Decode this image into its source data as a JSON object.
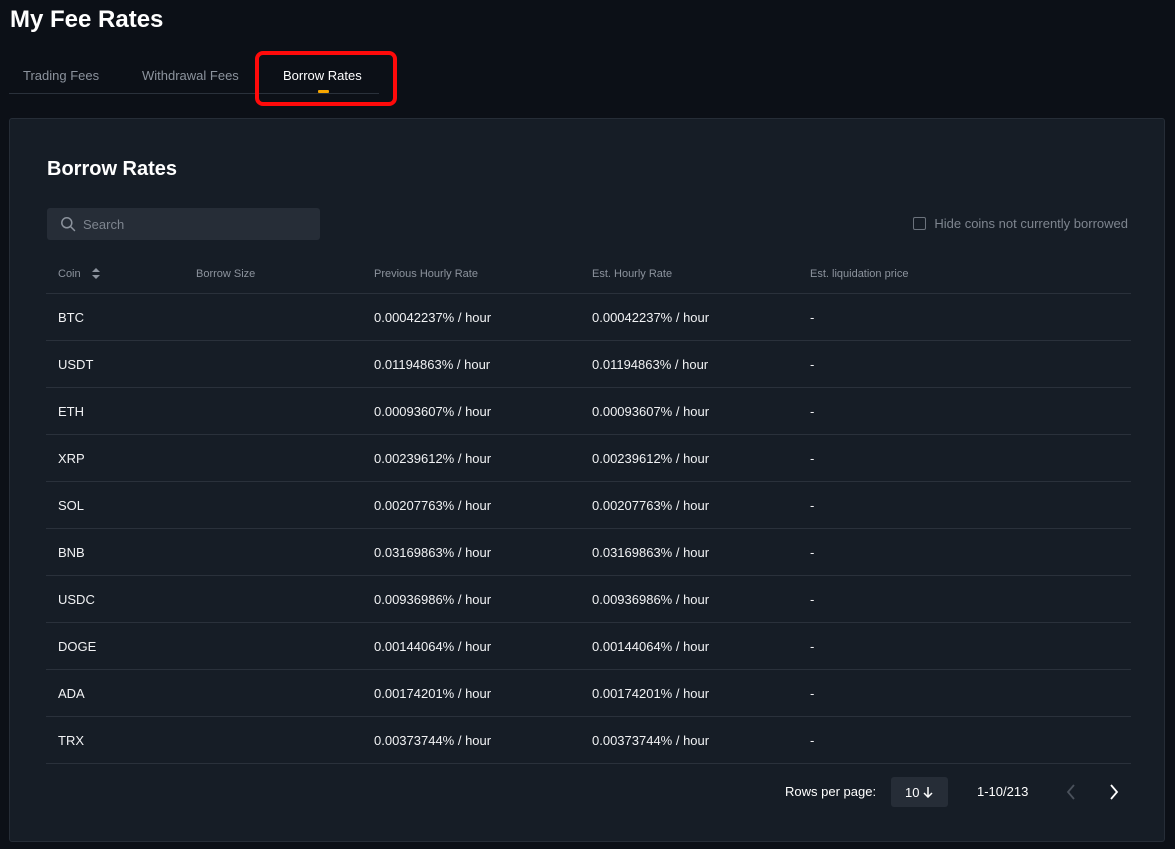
{
  "header": {
    "title": "My Fee Rates"
  },
  "tabs": [
    {
      "label": "Trading Fees"
    },
    {
      "label": "Withdrawal Fees"
    },
    {
      "label": "Borrow Rates"
    }
  ],
  "accent_color": "#f7a600",
  "panel": {
    "title": "Borrow Rates",
    "search_placeholder": "Search",
    "hide_label": "Hide coins not currently borrowed"
  },
  "table": {
    "columns": [
      "Coin",
      "Borrow Size",
      "Previous Hourly Rate",
      "Est. Hourly Rate",
      "Est. liquidation price"
    ],
    "rows": [
      {
        "coin": "BTC",
        "borrow_size": "",
        "prev_rate": "0.00042237% / hour",
        "est_rate": "0.00042237% / hour",
        "liq_price": "-"
      },
      {
        "coin": "USDT",
        "borrow_size": "",
        "prev_rate": "0.01194863% / hour",
        "est_rate": "0.01194863% / hour",
        "liq_price": "-"
      },
      {
        "coin": "ETH",
        "borrow_size": "",
        "prev_rate": "0.00093607% / hour",
        "est_rate": "0.00093607% / hour",
        "liq_price": "-"
      },
      {
        "coin": "XRP",
        "borrow_size": "",
        "prev_rate": "0.00239612% / hour",
        "est_rate": "0.00239612% / hour",
        "liq_price": "-"
      },
      {
        "coin": "SOL",
        "borrow_size": "",
        "prev_rate": "0.00207763% / hour",
        "est_rate": "0.00207763% / hour",
        "liq_price": "-"
      },
      {
        "coin": "BNB",
        "borrow_size": "",
        "prev_rate": "0.03169863% / hour",
        "est_rate": "0.03169863% / hour",
        "liq_price": "-"
      },
      {
        "coin": "USDC",
        "borrow_size": "",
        "prev_rate": "0.00936986% / hour",
        "est_rate": "0.00936986% / hour",
        "liq_price": "-"
      },
      {
        "coin": "DOGE",
        "borrow_size": "",
        "prev_rate": "0.00144064% / hour",
        "est_rate": "0.00144064% / hour",
        "liq_price": "-"
      },
      {
        "coin": "ADA",
        "borrow_size": "",
        "prev_rate": "0.00174201% / hour",
        "est_rate": "0.00174201% / hour",
        "liq_price": "-"
      },
      {
        "coin": "TRX",
        "borrow_size": "",
        "prev_rate": "0.00373744% / hour",
        "est_rate": "0.00373744% / hour",
        "liq_price": "-"
      }
    ]
  },
  "pagination": {
    "rows_per_page_label": "Rows per page:",
    "rows_per_page_value": "10",
    "range": "1-10/213"
  }
}
